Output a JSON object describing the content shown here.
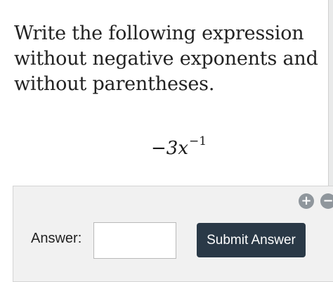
{
  "question": {
    "text": "Write the following expression without negative exponents and without parentheses.",
    "expression_base": "−3x",
    "expression_exponent": "−1"
  },
  "answer": {
    "label": "Answer:",
    "input_value": "",
    "submit_label": "Submit Answer"
  },
  "controls": {
    "add_icon_glyph": "+",
    "remove_icon_glyph": "−"
  },
  "colors": {
    "submit_button": "#2a3947",
    "panel_background": "#f1f1f1",
    "icon_gray": "#8f969c"
  }
}
